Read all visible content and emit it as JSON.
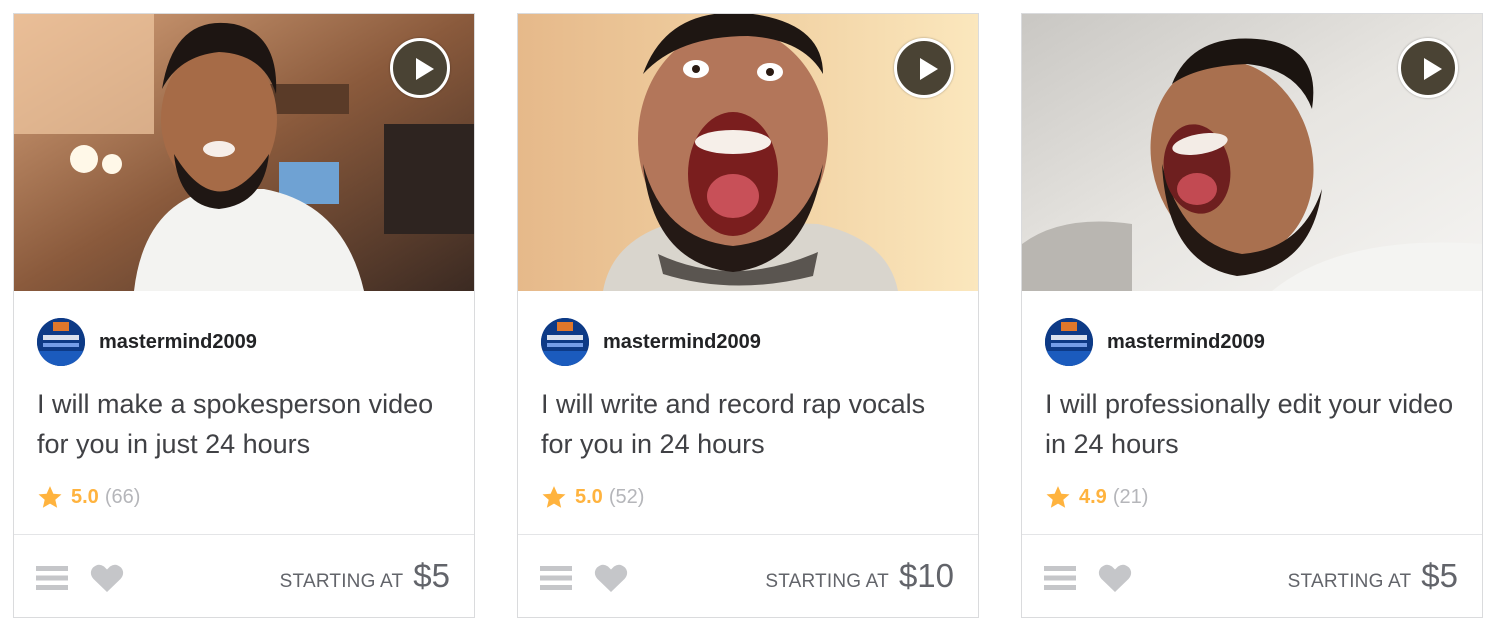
{
  "cards": [
    {
      "seller": "mastermind2009",
      "title": "I will make a spokesperson video for you in just 24 hours",
      "rating": "5.0",
      "reviews": "(66)",
      "starting_label": "STARTING AT",
      "price": "$5"
    },
    {
      "seller": "mastermind2009",
      "title": "I will write and record rap vocals for you in 24 hours",
      "rating": "5.0",
      "reviews": "(52)",
      "starting_label": "STARTING AT",
      "price": "$10"
    },
    {
      "seller": "mastermind2009",
      "title": "I will professionally edit your video in 24 hours",
      "rating": "4.9",
      "reviews": "(21)",
      "starting_label": "STARTING AT",
      "price": "$5"
    }
  ],
  "icons": {
    "play": "play-icon",
    "star": "star-icon",
    "menu": "list-menu-icon",
    "heart": "heart-icon"
  },
  "colors": {
    "rating": "#ffb33e",
    "price": "#62646a",
    "border": "#dadbdd",
    "icon": "#c5c6c9"
  }
}
